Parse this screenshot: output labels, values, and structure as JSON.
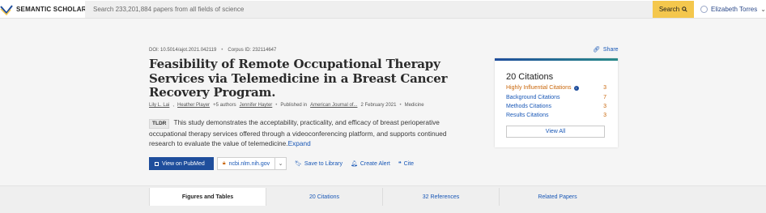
{
  "header": {
    "logo_text": "SEMANTIC SCHOLAR",
    "search_placeholder": "Search 233,201,884 papers from all fields of science",
    "search_button": "Search",
    "user_name": "Elizabeth Torres",
    "icons": {
      "logo": "semantic-scholar-logo",
      "search": "search-icon",
      "user": "user-icon",
      "chevron": "chevron-down-icon"
    }
  },
  "paper": {
    "doi": "DOI: 10.5014/ajot.2021.042119",
    "corpus": "Corpus ID: 232114647",
    "title": "Feasibility of Remote Occupational Therapy Services via Telemedicine in a Breast Cancer Recovery Program.",
    "authors": [
      "Lily L. Lai",
      "Heather Player"
    ],
    "more_authors": "+5 authors",
    "last_author": "Jennifer Hayter",
    "published_prefix": "Published in",
    "venue": "American Journal of...",
    "date": "2 February 2021",
    "field": "Medicine",
    "tldr_badge": "TLDR",
    "tldr_text": "This study demonstrates the acceptability, practicality, and efficacy of breast perioperative occupational therapy services offered through a videoconferencing platform, and supports continued research to evaluate the value of telemedicine.",
    "tldr_expand": "Expand"
  },
  "actions": {
    "pubmed": "View on PubMed",
    "ncbi": "ncbi.nlm.nih.gov",
    "save": "Save to Library",
    "alert": "Create Alert",
    "cite": "Cite",
    "share": "Share"
  },
  "citations": {
    "title": "20 Citations",
    "rows": [
      {
        "label": "Highly Influential Citations",
        "count": "3"
      },
      {
        "label": "Background Citations",
        "count": "7"
      },
      {
        "label": "Methods Citations",
        "count": "3"
      },
      {
        "label": "Results Citations",
        "count": "3"
      }
    ],
    "view_all": "View All"
  },
  "tabs": [
    {
      "label": "Figures and Tables"
    },
    {
      "label": "20 Citations"
    },
    {
      "label": "32 References"
    },
    {
      "label": "Related Papers"
    }
  ],
  "colors": {
    "link": "#1857b6",
    "accent": "#f4c74d",
    "highlight": "#c9660a",
    "primary": "#1f4e9c"
  }
}
